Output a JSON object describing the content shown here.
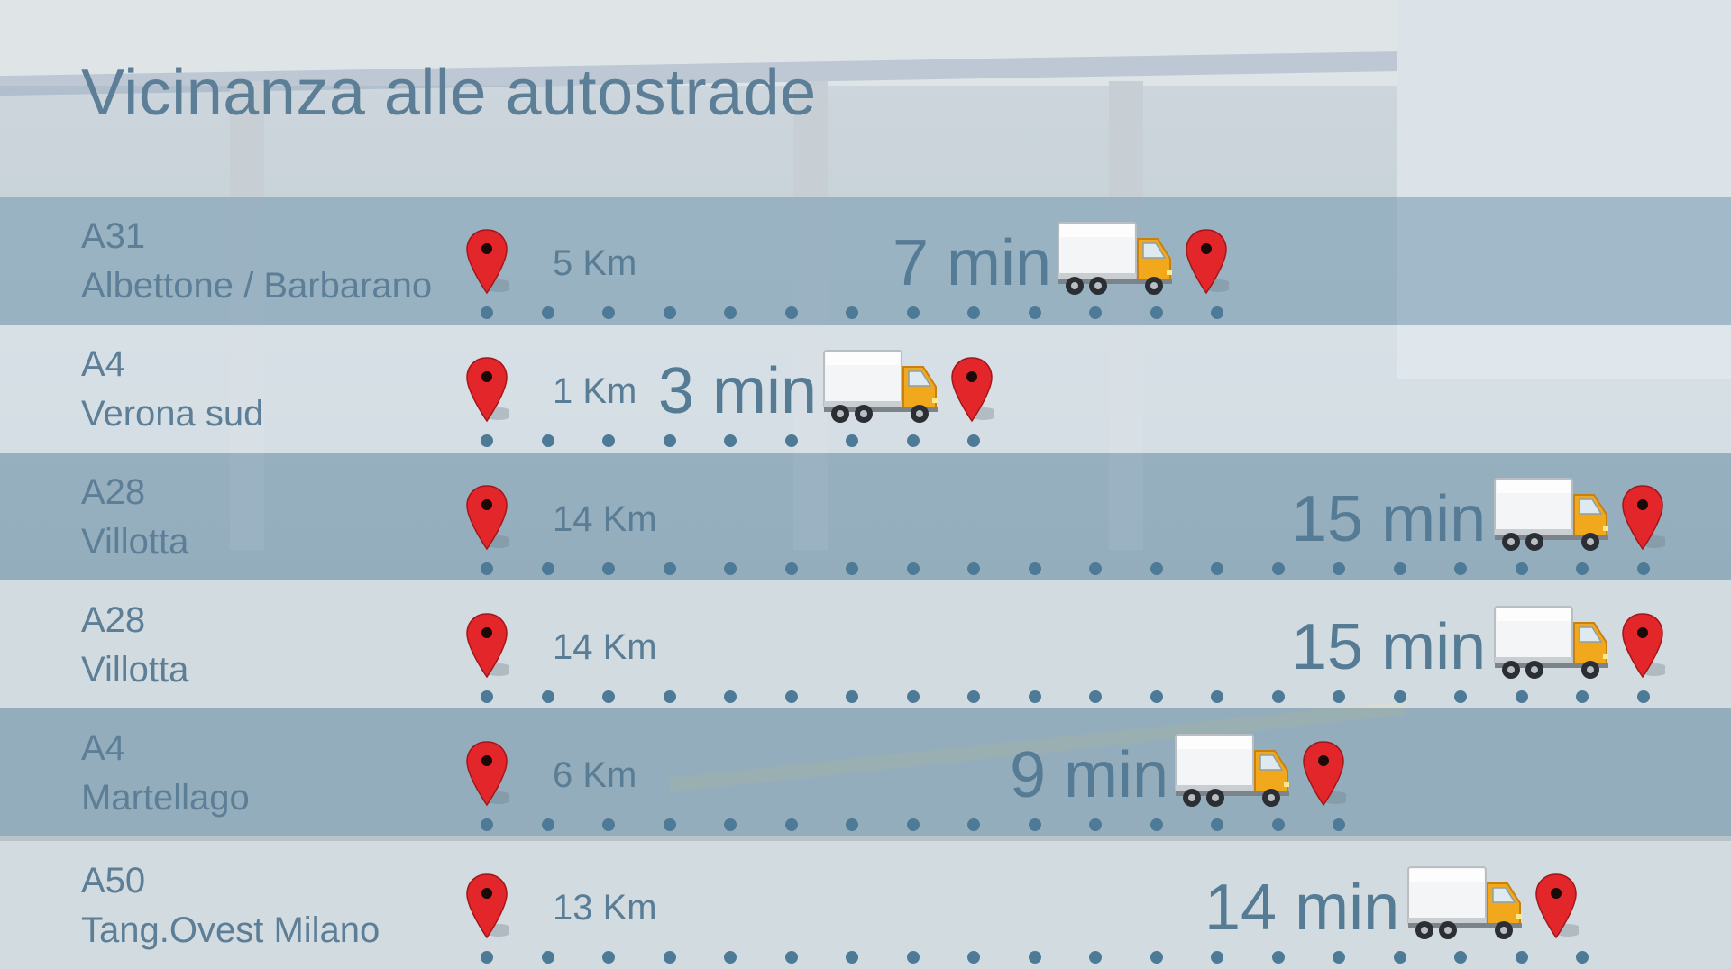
{
  "title": "Vicinanza alle autostrade",
  "routes": [
    {
      "code": "A31",
      "name": "Albettone / Barbarano",
      "km": "5 Km",
      "min": "7 min"
    },
    {
      "code": "A4",
      "name": "Verona sud",
      "km": "1 Km",
      "min": "3 min"
    },
    {
      "code": "A28",
      "name": "Villotta",
      "km": "14 Km",
      "min": "15 min"
    },
    {
      "code": "A28",
      "name": "Villotta",
      "km": "14 Km",
      "min": "15 min"
    },
    {
      "code": "A4",
      "name": "Martellago",
      "km": "6 Km",
      "min": "9 min"
    },
    {
      "code": "A50",
      "name": "Tang.Ovest Milano",
      "km": "13 Km",
      "min": "14 min"
    }
  ],
  "icons": {
    "start": "map-pin-icon",
    "vehicle": "truck-icon",
    "end": "map-pin-icon"
  },
  "colors": {
    "text": "#5c7f97",
    "dots": "#4d7a96",
    "pin": "#e3262a",
    "truck_cab": "#f2a81d"
  }
}
